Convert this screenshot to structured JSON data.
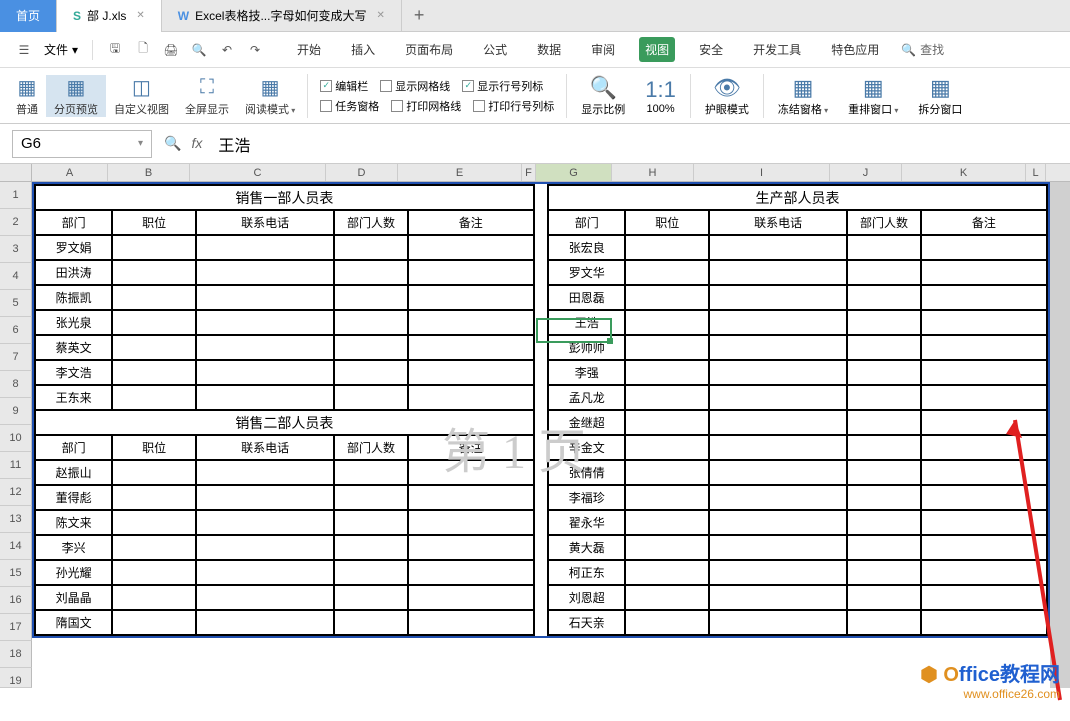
{
  "tabs": {
    "home": "首页",
    "file1": "部 J.xls",
    "file2": "Excel表格技...字母如何变成大写"
  },
  "menu": {
    "file": "文件",
    "tabs": [
      "开始",
      "插入",
      "页面布局",
      "公式",
      "数据",
      "审阅",
      "视图",
      "安全",
      "开发工具",
      "特色应用"
    ],
    "active": "视图",
    "search": "查找"
  },
  "ribbon": {
    "normal": "普通",
    "pagebreak": "分页预览",
    "custom": "自定义视图",
    "fullscreen": "全屏显示",
    "reading": "阅读模式",
    "checks": {
      "formula_bar": "编辑栏",
      "gridlines": "显示网格线",
      "row_col_headers": "显示行号列标",
      "task_pane": "任务窗格",
      "print_gridlines": "打印网格线",
      "print_headers": "打印行号列标"
    },
    "zoom": "显示比例",
    "zoom100": "100%",
    "eyecare": "护眼模式",
    "freeze": "冻结窗格",
    "arrange": "重排窗口",
    "split": "拆分窗口"
  },
  "formula_bar": {
    "cell_ref": "G6",
    "value": "王浩"
  },
  "columns": [
    "A",
    "B",
    "C",
    "D",
    "E",
    "F",
    "G",
    "H",
    "I",
    "J",
    "K",
    "L"
  ],
  "watermark": "第 1 页",
  "tables": {
    "sales1_title": "销售一部人员表",
    "sales2_title": "销售二部人员表",
    "prod_title": "生产部人员表",
    "headers": [
      "部门",
      "职位",
      "联系电话",
      "部门人数",
      "备注"
    ],
    "sales1_names": [
      "罗文娟",
      "田洪涛",
      "陈振凯",
      "张光泉",
      "蔡英文",
      "李文浩",
      "王东来"
    ],
    "sales2_names": [
      "赵振山",
      "董得彪",
      "陈文来",
      "李兴",
      "孙光耀",
      "刘晶晶",
      "隋国文"
    ],
    "prod_names": [
      "张宏良",
      "罗文华",
      "田恩磊",
      "王浩",
      "彭帅帅",
      "李强",
      "孟凡龙",
      "金继超",
      "辛金文",
      "张倩倩",
      "李福珍",
      "翟永华",
      "黄大磊",
      "柯正东",
      "刘恩超",
      "石天亲"
    ]
  },
  "logo": {
    "main_prefix": "O",
    "main": "ffice教程网",
    "sub": "www.office26.com"
  }
}
